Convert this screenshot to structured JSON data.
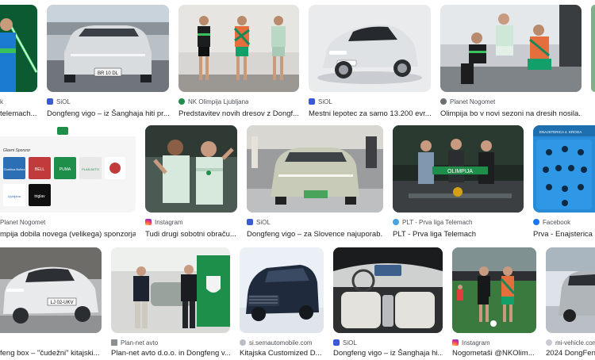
{
  "results": [
    {
      "source": "",
      "title": "telemach..."
    },
    {
      "source": "SiOL",
      "title": "Dongfeng vigo – iz Šanghaja hiti pr..."
    },
    {
      "source": "NK Olimpija Ljubljana",
      "title": "Predstavitev novih dresov z Dongf..."
    },
    {
      "source": "SiOL",
      "title": "Mestni lepotec za samo 13.200 evr..."
    },
    {
      "source": "Planet Nogomet",
      "title": "Olimpija bo v novi sezoni na dresih nosila..."
    },
    {
      "source": "",
      "title": ""
    },
    {
      "source": "Planet Nogomet",
      "title": "mpija dobila novega (velikega) sponzorja..."
    },
    {
      "source": "Instagram",
      "title": "Tudi drugi sobotni obraču..."
    },
    {
      "source": "SiOL",
      "title": "Dongfeng vigo – za Slovence najuporab..."
    },
    {
      "source": "PLT - Prva liga Telemach",
      "title": "PLT - Prva liga Telemach"
    },
    {
      "source": "Facebook",
      "title": "Prva - Enajsterica 4..."
    },
    {
      "source": "",
      "title": "feng box – \"čudežni\" kitajski..."
    },
    {
      "source": "Plan-net avto",
      "title": "Plan-net avto d.o.o. in Dongfeng v..."
    },
    {
      "source": "si.semautomobile.com",
      "title": "Kitajska Customized D..."
    },
    {
      "source": "SiOL",
      "title": "Dongfeng vigo – iz Šanghaja hi..."
    },
    {
      "source": "Instagram",
      "title": "Nogometaši @NKOlim..."
    },
    {
      "source": "mi-vehicle.com",
      "title": "2024 DongFen..."
    }
  ],
  "thumb_text": {
    "plate1": "BR 10 DL",
    "plate_fr": "LJ 02-UKV",
    "sponsors_heading": "Glavni Sponzor",
    "sponsor_logos": [
      "Gostilna Boltez",
      "BELL",
      "PUMA",
      "PLAN AVTO",
      "Ljubljana",
      "triglav",
      "mj"
    ],
    "banner": "OLIMPIJA",
    "lineup_title": "ENAJSTERICA 4. KROGA"
  },
  "colors": {
    "olimpija_green": "#1e8f4a",
    "result_title": "#1f1f1f",
    "source_text": "#4d5156"
  }
}
